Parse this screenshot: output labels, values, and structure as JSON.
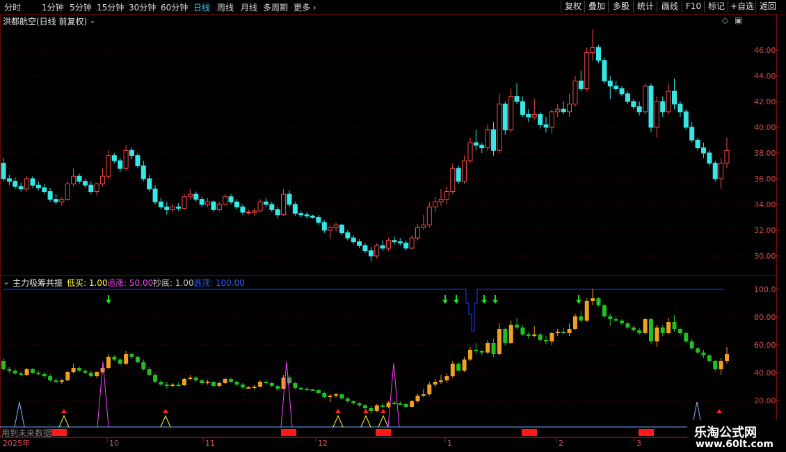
{
  "toolbar": {
    "periods": [
      "分时",
      "1分钟",
      "5分钟",
      "15分钟",
      "30分钟",
      "60分钟",
      "日线",
      "周线",
      "月线",
      "多周期",
      "更多"
    ],
    "active_period": "日线",
    "right_buttons": [
      "复权",
      "叠加",
      "多股",
      "统计",
      "画线",
      "F10",
      "标记",
      "+自选",
      "返回"
    ]
  },
  "main_chart": {
    "title": "洪都航空(日线 前复权)",
    "price_axis": [
      "46.00",
      "44.00",
      "42.00",
      "40.00",
      "38.00",
      "36.00",
      "34.00",
      "32.00",
      "30.00"
    ],
    "colors": {
      "up": "#ff4a4a",
      "down": "#35e8e8",
      "grid": "#5a0000"
    }
  },
  "indicator": {
    "name": "主力吸筹共振",
    "params": [
      {
        "label": "低买: 1.00",
        "color": "#ffff40"
      },
      {
        "label": "追涨: 50.00",
        "color": "#ff40ff"
      },
      {
        "label": "抄底: 1.00",
        "color": "#c8c8c8"
      },
      {
        "label": "逃顶: 100.00",
        "color": "#3060ff"
      }
    ],
    "axis": [
      "100.0",
      "80.00",
      "60.00",
      "40.00",
      "20.00"
    ],
    "note": "用到未来数据"
  },
  "date_axis": [
    "2025年",
    "10",
    "11",
    "12",
    "1",
    "2",
    "3"
  ],
  "watermark": {
    "line1": "乐淘公式网",
    "line2": "www.60lt.com"
  },
  "chart_data": {
    "type": "candlestick",
    "title": "洪都航空(日线 前复权)",
    "ylim": [
      29,
      47.5
    ],
    "x_ticks": [
      "2025年",
      "10",
      "11",
      "12",
      "1",
      "2",
      "3"
    ],
    "note": "approximate daily OHLC read from the screenshot",
    "ohlc": [
      [
        37.2,
        37.6,
        35.8,
        36.0
      ],
      [
        36.0,
        36.3,
        35.5,
        35.8
      ],
      [
        35.8,
        36.1,
        35.2,
        35.4
      ],
      [
        35.4,
        35.7,
        35.0,
        35.2
      ],
      [
        35.2,
        36.2,
        35.0,
        36.0
      ],
      [
        36.0,
        36.2,
        35.3,
        35.5
      ],
      [
        35.5,
        35.8,
        35.1,
        35.3
      ],
      [
        35.3,
        35.6,
        34.8,
        35.0
      ],
      [
        35.0,
        35.3,
        34.2,
        34.4
      ],
      [
        34.4,
        34.8,
        34.0,
        34.2
      ],
      [
        34.2,
        34.6,
        33.9,
        34.4
      ],
      [
        34.4,
        35.8,
        34.3,
        35.6
      ],
      [
        35.6,
        36.8,
        35.4,
        36.2
      ],
      [
        36.2,
        36.4,
        35.6,
        35.8
      ],
      [
        35.8,
        36.0,
        35.3,
        35.5
      ],
      [
        35.5,
        35.8,
        34.8,
        35.0
      ],
      [
        35.0,
        35.7,
        34.7,
        35.6
      ],
      [
        35.6,
        36.8,
        35.4,
        36.2
      ],
      [
        36.2,
        38.2,
        36.0,
        37.8
      ],
      [
        37.8,
        38.0,
        37.2,
        37.4
      ],
      [
        37.4,
        37.6,
        36.5,
        36.8
      ],
      [
        36.8,
        38.6,
        36.6,
        38.2
      ],
      [
        38.2,
        38.4,
        37.5,
        37.8
      ],
      [
        37.8,
        38.0,
        36.8,
        37.0
      ],
      [
        37.0,
        37.4,
        35.8,
        36.0
      ],
      [
        36.0,
        36.3,
        35.0,
        35.2
      ],
      [
        35.2,
        35.5,
        34.0,
        34.2
      ],
      [
        34.2,
        34.5,
        33.6,
        33.8
      ],
      [
        33.8,
        34.2,
        33.2,
        33.6
      ],
      [
        33.6,
        34.0,
        33.4,
        33.8
      ],
      [
        33.8,
        34.1,
        33.5,
        33.7
      ],
      [
        33.7,
        34.8,
        33.6,
        34.6
      ],
      [
        34.6,
        35.2,
        34.4,
        34.8
      ],
      [
        34.8,
        35.0,
        34.2,
        34.4
      ],
      [
        34.4,
        34.6,
        33.8,
        34.0
      ],
      [
        34.0,
        34.5,
        33.8,
        34.2
      ],
      [
        34.2,
        34.3,
        33.4,
        33.6
      ],
      [
        33.6,
        34.2,
        33.5,
        34.0
      ],
      [
        34.0,
        34.8,
        33.9,
        34.6
      ],
      [
        34.6,
        34.8,
        34.0,
        34.2
      ],
      [
        34.2,
        34.4,
        33.6,
        33.8
      ],
      [
        33.8,
        34.0,
        33.2,
        33.4
      ],
      [
        33.4,
        33.6,
        33.2,
        33.4
      ],
      [
        33.4,
        33.7,
        33.1,
        33.5
      ],
      [
        33.5,
        34.4,
        33.4,
        34.2
      ],
      [
        34.2,
        34.5,
        33.8,
        34.0
      ],
      [
        34.0,
        34.2,
        33.4,
        33.6
      ],
      [
        33.6,
        33.8,
        32.9,
        33.2
      ],
      [
        33.2,
        35.2,
        33.1,
        34.8
      ],
      [
        34.8,
        35.1,
        33.8,
        34.0
      ],
      [
        34.0,
        34.2,
        33.1,
        33.3
      ],
      [
        33.3,
        33.5,
        33.0,
        33.2
      ],
      [
        33.2,
        33.4,
        32.9,
        33.1
      ],
      [
        33.1,
        33.2,
        32.9,
        33.0
      ],
      [
        33.0,
        33.2,
        32.4,
        32.6
      ],
      [
        32.6,
        32.8,
        31.8,
        32.0
      ],
      [
        32.0,
        32.4,
        31.3,
        32.2
      ],
      [
        32.2,
        32.6,
        31.9,
        32.4
      ],
      [
        32.4,
        32.5,
        31.6,
        31.8
      ],
      [
        31.8,
        32.0,
        31.2,
        31.4
      ],
      [
        31.4,
        31.6,
        30.9,
        31.1
      ],
      [
        31.1,
        31.3,
        30.6,
        30.8
      ],
      [
        30.8,
        31.0,
        30.2,
        30.4
      ],
      [
        30.4,
        30.7,
        29.6,
        30.0
      ],
      [
        30.0,
        31.0,
        29.8,
        30.8
      ],
      [
        30.8,
        31.2,
        30.4,
        30.6
      ],
      [
        30.6,
        31.4,
        30.4,
        31.2
      ],
      [
        31.2,
        31.5,
        30.9,
        31.1
      ],
      [
        31.1,
        31.4,
        30.8,
        31.0
      ],
      [
        31.0,
        31.2,
        30.4,
        30.6
      ],
      [
        30.6,
        31.6,
        30.5,
        31.4
      ],
      [
        31.4,
        32.5,
        31.2,
        32.2
      ],
      [
        32.2,
        33.2,
        32.0,
        32.4
      ],
      [
        32.4,
        34.2,
        32.2,
        33.8
      ],
      [
        33.8,
        34.6,
        33.4,
        34.2
      ],
      [
        34.2,
        35.2,
        33.9,
        34.4
      ],
      [
        34.4,
        35.4,
        34.0,
        35.0
      ],
      [
        35.0,
        37.2,
        34.8,
        36.8
      ],
      [
        36.8,
        37.0,
        35.6,
        35.8
      ],
      [
        35.8,
        37.8,
        35.6,
        37.4
      ],
      [
        37.4,
        39.2,
        37.2,
        38.8
      ],
      [
        38.8,
        39.8,
        38.2,
        38.6
      ],
      [
        38.6,
        38.8,
        38.0,
        38.4
      ],
      [
        38.4,
        40.2,
        38.2,
        39.8
      ],
      [
        39.8,
        40.4,
        37.8,
        38.2
      ],
      [
        38.2,
        42.6,
        38.0,
        41.8
      ],
      [
        41.8,
        42.0,
        39.4,
        39.8
      ],
      [
        39.8,
        43.0,
        39.6,
        42.4
      ],
      [
        42.4,
        43.4,
        41.8,
        42.0
      ],
      [
        42.0,
        42.4,
        40.8,
        41.0
      ],
      [
        41.0,
        41.4,
        40.4,
        40.8
      ],
      [
        40.8,
        42.2,
        40.6,
        41.0
      ],
      [
        41.0,
        41.2,
        39.9,
        40.2
      ],
      [
        40.2,
        40.8,
        39.6,
        40.0
      ],
      [
        40.0,
        41.4,
        39.5,
        41.2
      ],
      [
        41.2,
        41.8,
        40.8,
        41.4
      ],
      [
        41.4,
        42.0,
        41.0,
        41.2
      ],
      [
        41.2,
        42.6,
        40.8,
        41.8
      ],
      [
        41.8,
        44.0,
        41.6,
        43.6
      ],
      [
        43.6,
        44.4,
        42.8,
        43.0
      ],
      [
        43.0,
        46.2,
        42.8,
        45.8
      ],
      [
        45.8,
        47.6,
        45.2,
        46.2
      ],
      [
        46.2,
        46.4,
        45.0,
        45.2
      ],
      [
        45.2,
        45.4,
        43.4,
        43.6
      ],
      [
        43.6,
        44.0,
        42.2,
        43.2
      ],
      [
        43.2,
        43.6,
        42.8,
        43.0
      ],
      [
        43.0,
        43.2,
        42.4,
        42.6
      ],
      [
        42.6,
        42.8,
        41.8,
        42.0
      ],
      [
        42.0,
        42.2,
        41.4,
        41.6
      ],
      [
        41.6,
        42.0,
        40.9,
        41.2
      ],
      [
        41.2,
        43.4,
        41.0,
        43.2
      ],
      [
        43.2,
        43.4,
        39.6,
        40.0
      ],
      [
        40.0,
        42.4,
        39.2,
        42.0
      ],
      [
        42.0,
        42.4,
        40.8,
        41.2
      ],
      [
        41.2,
        43.4,
        41.0,
        42.8
      ],
      [
        42.8,
        43.8,
        41.4,
        41.8
      ],
      [
        41.8,
        42.0,
        40.8,
        41.2
      ],
      [
        41.2,
        41.4,
        39.8,
        40.0
      ],
      [
        40.0,
        40.4,
        38.8,
        39.0
      ],
      [
        39.0,
        39.2,
        38.2,
        38.4
      ],
      [
        38.4,
        38.8,
        37.6,
        38.0
      ],
      [
        38.0,
        38.2,
        37.0,
        37.2
      ],
      [
        37.2,
        37.4,
        35.8,
        36.0
      ],
      [
        36.0,
        37.6,
        35.2,
        37.2
      ],
      [
        37.2,
        39.2,
        36.8,
        38.2
      ]
    ]
  }
}
